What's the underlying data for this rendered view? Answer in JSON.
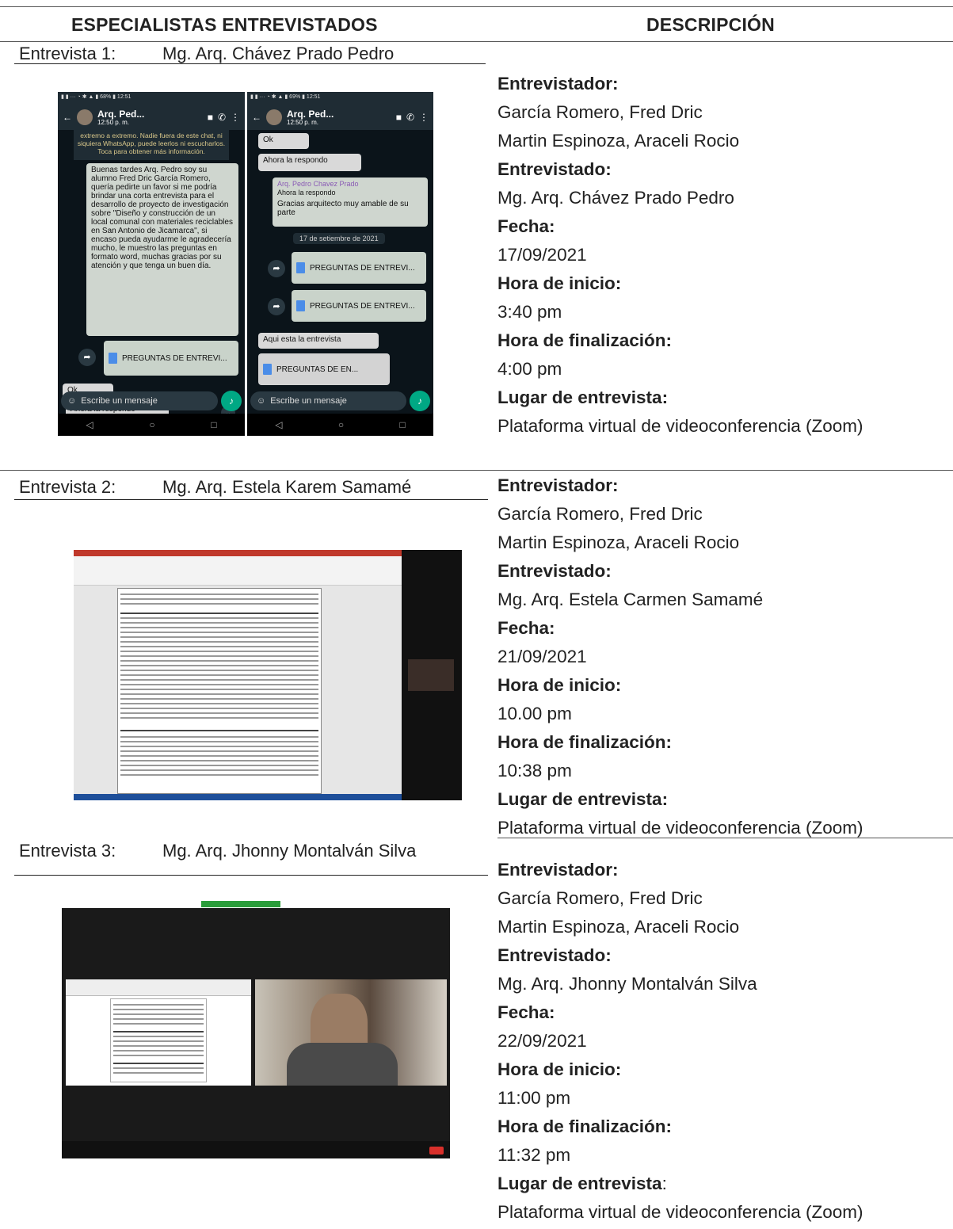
{
  "headers": {
    "left": "ESPECIALISTAS ENTREVISTADOS",
    "right": "DESCRIPCIÓN"
  },
  "interviews": [
    {
      "label": "Entrevista 1:",
      "name": "Mg. Arq. Chávez Prado Pedro",
      "fields": {
        "entrevistador_label": "Entrevistador:",
        "entrevistador_1": "García Romero, Fred Dric",
        "entrevistador_2": "Martin Espinoza, Araceli Rocio",
        "entrevistado_label": "Entrevistado:",
        "entrevistado": "Mg. Arq. Chávez Prado Pedro",
        "fecha_label": "Fecha:",
        "fecha": "17/09/2021",
        "inicio_label": "Hora de inicio:",
        "inicio": "3:40 pm",
        "fin_label": "Hora de finalización:",
        "fin": "4:00 pm",
        "lugar_label": "Lugar de entrevista:",
        "lugar": "Plataforma virtual de videoconferencia (Zoom)"
      },
      "screenshot": {
        "contact": "Arq. Ped...",
        "time": "12:50 p. m.",
        "left_top_text": "extremo a extremo. Nadie fuera de este chat, ni siquiera WhatsApp, puede leerlos ni escucharlos. Toca para obtener más información.",
        "long_message": "Buenas tardes Arq. Pedro soy su alumno Fred Dric García Romero, quería pedirte un favor si me podría brindar una corta entrevista para el desarrollo de proyecto de investigación sobre \"Diseño y construcción de un local comunal con materiales reciclables en San Antonio de Jicamarca\", si encaso pueda ayudarme le agradecería mucho, le muestro las preguntas en formato word, muchas gracias por su atención y que tenga un buen día.",
        "doc_name": "PREGUNTAS DE ENTREVI...",
        "doc_name_short": "PREGUNTAS DE EN...",
        "ok": "Ok",
        "reply": "Ahora la respondo",
        "quote_author": "Arq. Pedro Chavez Prado",
        "thanks": "Gracias arquitecto muy amable de su parte",
        "date_chip": "17 de setiembre de 2021",
        "here": "Aqui esta la entrevista",
        "composer": "Escribe un mensaje"
      }
    },
    {
      "label": "Entrevista 2:",
      "name": "Mg. Arq. Estela Karem Samamé",
      "fields": {
        "entrevistador_label": "Entrevistador:",
        "entrevistador_1": "García Romero, Fred Dric",
        "entrevistador_2": "Martin Espinoza, Araceli Rocio",
        "entrevistado_label": "Entrevistado:",
        "entrevistado": "Mg. Arq. Estela Carmen Samamé",
        "fecha_label": "Fecha:",
        "fecha": "21/09/2021",
        "inicio_label": "Hora de inicio:",
        "inicio": "10.00 pm",
        "fin_label": "Hora de finalización:",
        "fin": "10:38 pm",
        "lugar_label": "Lugar de entrevista:",
        "lugar": "Plataforma virtual de videoconferencia (Zoom)"
      }
    },
    {
      "label": "Entrevista 3:",
      "name": "Mg. Arq. Jhonny Montalván Silva",
      "fields": {
        "entrevistador_label": "Entrevistador:",
        "entrevistador_1": "García Romero, Fred Dric",
        "entrevistador_2": "Martin Espinoza, Araceli Rocio",
        "entrevistado_label": "Entrevistado:",
        "entrevistado": "Mg. Arq. Jhonny Montalván Silva",
        "fecha_label": "Fecha:",
        "fecha": "22/09/2021",
        "inicio_label": "Hora de inicio:",
        "inicio": "11:00 pm",
        "fin_label": "Hora de finalización:",
        "fin": "11:32 pm",
        "lugar_label": "Lugar de entrevista",
        "lugar_colon": ":",
        "lugar": "Plataforma virtual de videoconferencia (Zoom)"
      }
    }
  ],
  "colors": {
    "rule": "#555555",
    "whatsapp_bg": "#0b141a",
    "whatsapp_accent": "#00a884",
    "zoom_bg": "#1a1a1a"
  }
}
